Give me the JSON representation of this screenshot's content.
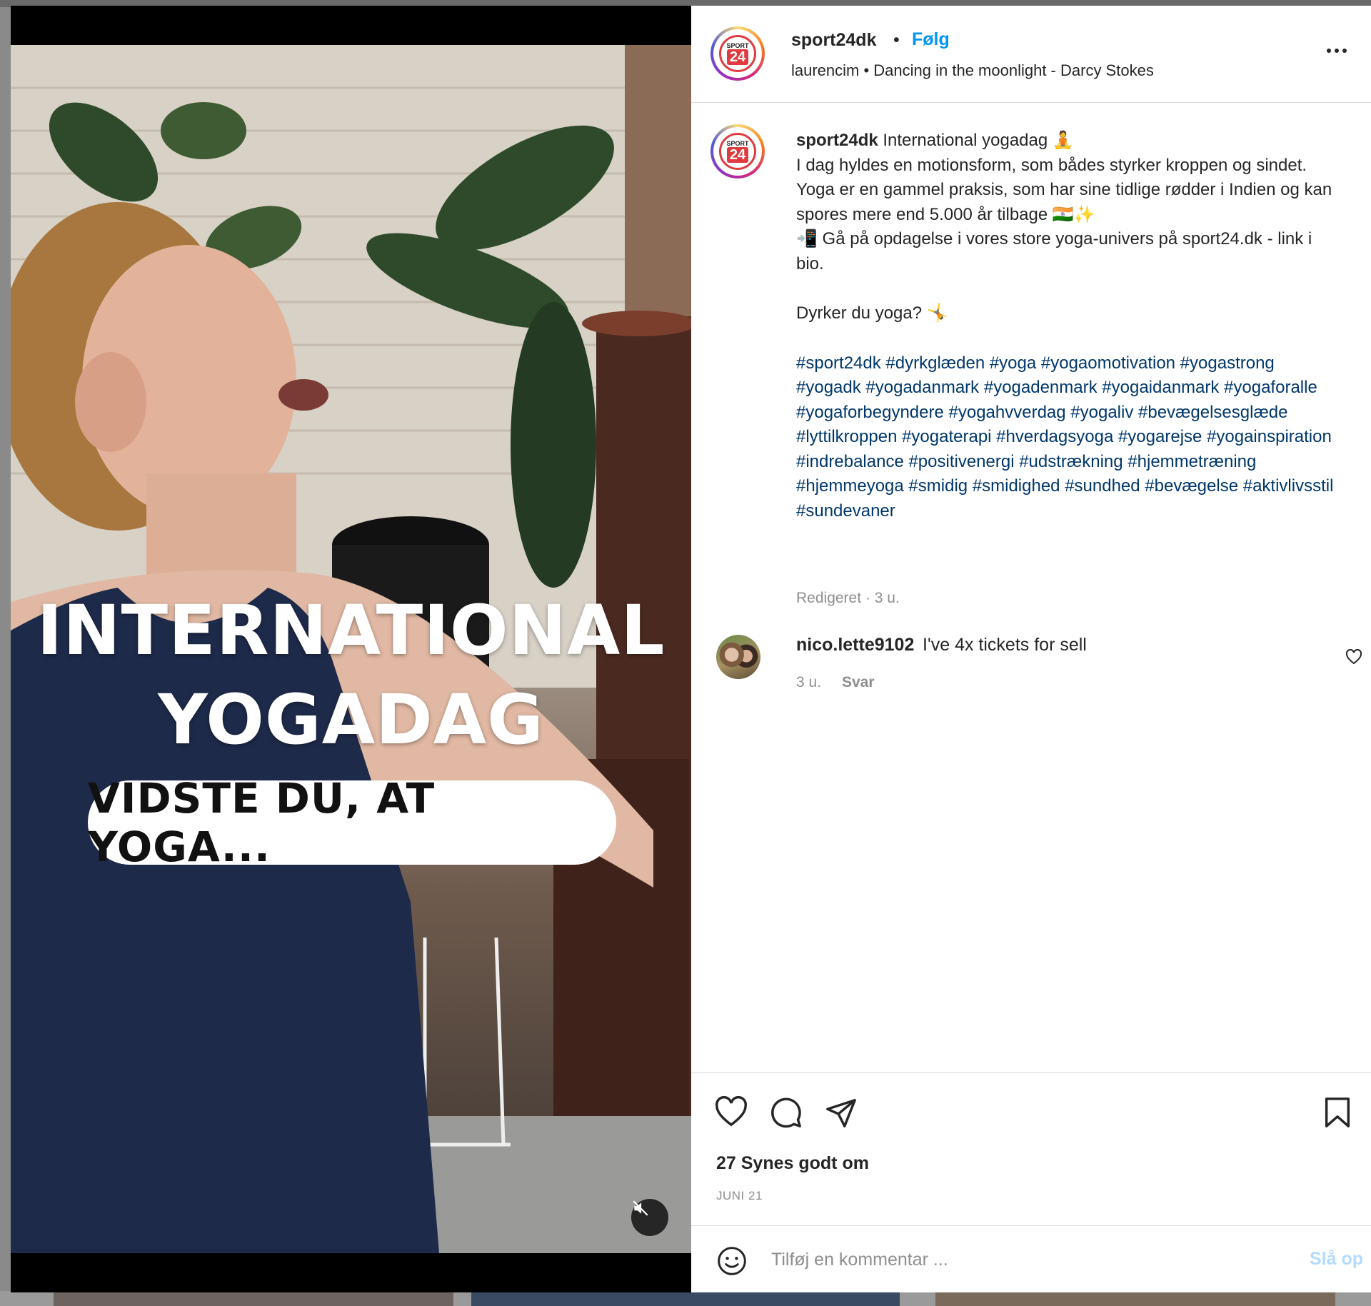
{
  "post": {
    "account": "sport24dk",
    "follow_label": "Følg",
    "separator": "•",
    "subtitle": "laurencim • Dancing in the moonlight - Darcy Stokes",
    "logo_text_top": "SPORT",
    "logo_text_bottom": "24"
  },
  "video": {
    "headline_line1": "INTERNATIONAL",
    "headline_line2": "YOGADAG",
    "pill_text": "VIDSTE DU, AT YOGA..."
  },
  "caption": {
    "username": "sport24dk",
    "title": "International yogadag 🧘",
    "line1": "I dag hyldes en motionsform, som bådes styrker kroppen og sindet.",
    "line2": "Yoga er en gammel praksis, som har sine tidlige rødder i Indien og kan spores mere end 5.000 år tilbage 🇮🇳✨",
    "line3": "📲 Gå på opdagelse i vores store yoga-univers på sport24.dk - link i bio.",
    "question": "Dyrker du yoga? 🤸",
    "hashtags": "#sport24dk #dyrkglæden #yoga #yogaomotivation #yogastrong #yogadk #yogadanmark #yogadenmark #yogaidanmark #yogaforalle #yogaforbegyndere #yogahvverdag #yogaliv #bevægelsesglæde #lyttilkroppen #yogaterapi #hverdagsyoga #yogarejse #yogainspiration #indrebalance #positivenergi #udstrækning #hjemmetræning #hjemmeyoga #smidig #smidighed #sundhed #bevægelse #aktivlivsstil #sundevaner",
    "meta": "Redigeret · 3 u."
  },
  "comment": {
    "username": "nico.lette9102",
    "text": "I've 4x tickets for sell",
    "time": "3 u.",
    "reply_label": "Svar"
  },
  "actions": {
    "likes": "27 Synes godt om",
    "date": "JUNI 21"
  },
  "add_comment": {
    "placeholder": "Tilføj en kommentar ...",
    "post_label": "Slå op"
  },
  "colors": {
    "follow": "#0095f6",
    "hashtag": "#00376b",
    "post_disabled": "#b3dbff",
    "brand_red": "#e03a3e"
  }
}
